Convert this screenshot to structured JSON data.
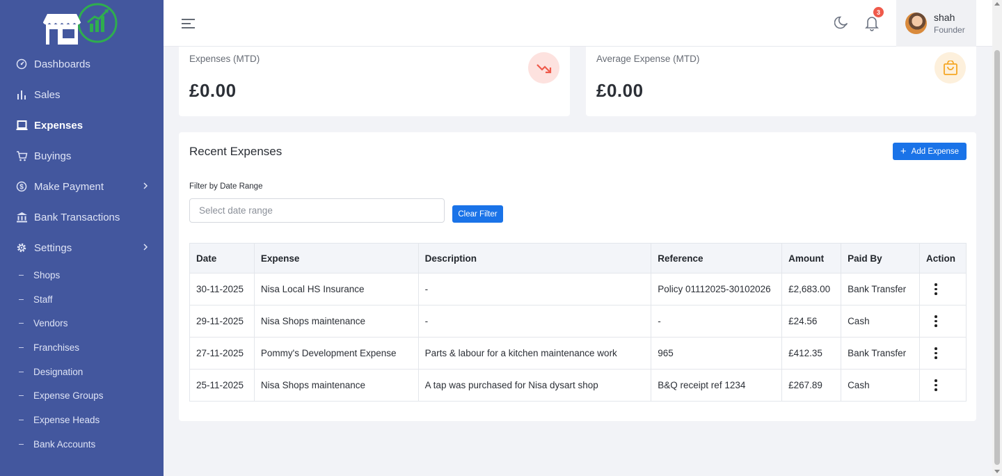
{
  "sidebar": {
    "nav": [
      {
        "label": "Dashboards",
        "icon": "dashboard-gauge-icon"
      },
      {
        "label": "Sales",
        "icon": "bar-chart-icon"
      },
      {
        "label": "Expenses",
        "icon": "laptop-icon",
        "active": true
      },
      {
        "label": "Buyings",
        "icon": "cart-icon"
      },
      {
        "label": "Make Payment",
        "icon": "dollar-circle-icon",
        "has_children": true
      },
      {
        "label": "Bank Transactions",
        "icon": "bank-icon"
      },
      {
        "label": "Settings",
        "icon": "gear-icon",
        "has_children": true
      }
    ],
    "settings_sub": [
      {
        "label": "Shops"
      },
      {
        "label": "Staff"
      },
      {
        "label": "Vendors"
      },
      {
        "label": "Franchises"
      },
      {
        "label": "Designation"
      },
      {
        "label": "Expense Groups"
      },
      {
        "label": "Expense Heads"
      },
      {
        "label": "Bank Accounts"
      }
    ]
  },
  "header": {
    "notification_count": "3",
    "user": {
      "name": "shah",
      "role": "Founder"
    }
  },
  "stats": [
    {
      "label": "Expenses (MTD)",
      "value": "£0.00",
      "icon": "trending-down-icon",
      "accent": "#ef5a4b"
    },
    {
      "label": "Average Expense (MTD)",
      "value": "£0.00",
      "icon": "shopping-bag-icon",
      "accent": "#f5a623"
    }
  ],
  "recent": {
    "title": "Recent Expenses",
    "add_label": "Add Expense",
    "filter_label": "Filter by Date Range",
    "date_placeholder": "Select date range",
    "clear_label": "Clear Filter",
    "columns": [
      "Date",
      "Expense",
      "Description",
      "Reference",
      "Amount",
      "Paid By",
      "Action"
    ],
    "rows": [
      {
        "date": "30-11-2025",
        "expense": "Nisa Local HS Insurance",
        "description": "-",
        "reference": "Policy 01112025-30102026",
        "amount": "£2,683.00",
        "paid_by": "Bank Transfer"
      },
      {
        "date": "29-11-2025",
        "expense": "Nisa Shops maintenance",
        "description": "-",
        "reference": "-",
        "amount": "£24.56",
        "paid_by": "Cash"
      },
      {
        "date": "27-11-2025",
        "expense": "Pommy's Development Expense",
        "description": "Parts & labour for a kitchen maintenance work",
        "reference": "965",
        "amount": "£412.35",
        "paid_by": "Bank Transfer"
      },
      {
        "date": "25-11-2025",
        "expense": "Nisa Shops maintenance",
        "description": "A tap was purchased for Nisa dysart shop",
        "reference": "B&Q receipt ref 1234",
        "amount": "£267.89",
        "paid_by": "Cash"
      }
    ]
  },
  "colors": {
    "sidebar_bg": "#43579e",
    "primary": "#1a73e8",
    "logo_green": "#2fae4e"
  }
}
